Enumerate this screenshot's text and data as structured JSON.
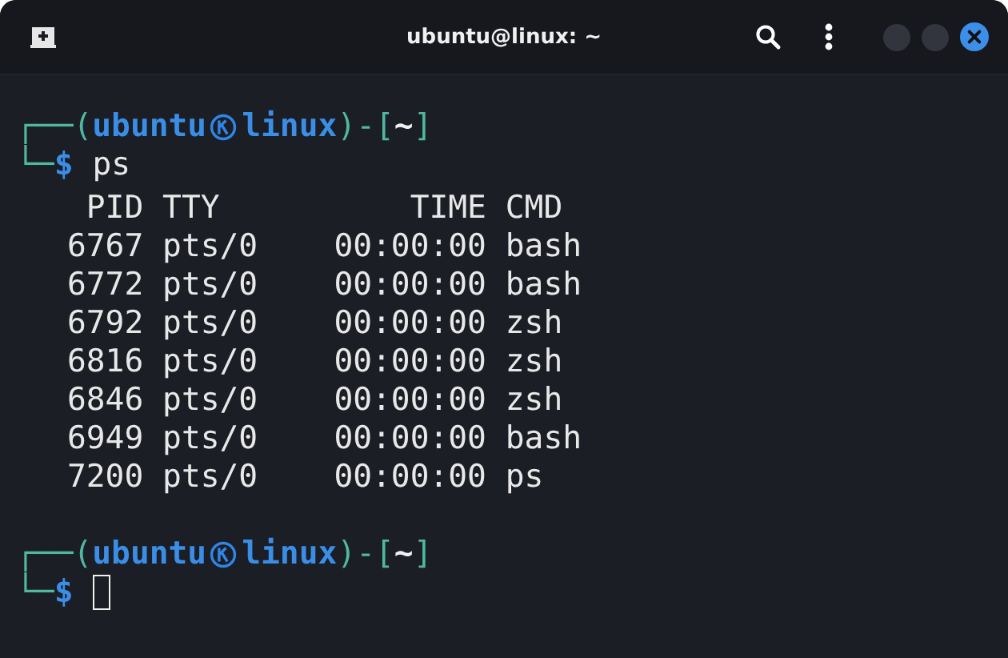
{
  "window": {
    "title": "ubuntu@linux: ~"
  },
  "sessions": [
    {
      "prompt": {
        "open": "┌──(",
        "user": "ubuntu",
        "host": "linux",
        "close": ")-[",
        "path": "~",
        "end": "]",
        "corner": "└─",
        "symbol": "$"
      },
      "command": "ps",
      "cursor": false,
      "output": {
        "columns": [
          "PID",
          "TTY",
          "TIME",
          "CMD"
        ],
        "rows": [
          [
            "6767",
            "pts/0",
            "00:00:00",
            "bash"
          ],
          [
            "6772",
            "pts/0",
            "00:00:00",
            "bash"
          ],
          [
            "6792",
            "pts/0",
            "00:00:00",
            "zsh"
          ],
          [
            "6816",
            "pts/0",
            "00:00:00",
            "zsh"
          ],
          [
            "6846",
            "pts/0",
            "00:00:00",
            "zsh"
          ],
          [
            "6949",
            "pts/0",
            "00:00:00",
            "bash"
          ],
          [
            "7200",
            "pts/0",
            "00:00:00",
            "ps"
          ]
        ]
      }
    },
    {
      "prompt": {
        "open": "┌──(",
        "user": "ubuntu",
        "host": "linux",
        "close": ")-[",
        "path": "~",
        "end": "]",
        "corner": "└─",
        "symbol": "$"
      },
      "cursor": true
    }
  ]
}
